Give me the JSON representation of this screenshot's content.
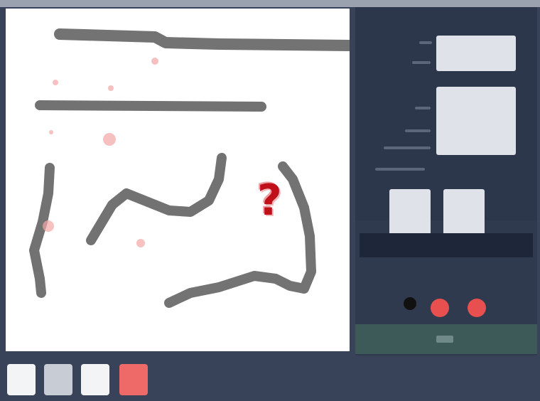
{
  "canvas": {
    "background": "#ffffff",
    "stroke_color": "#555555",
    "marker_color": "#f2a0a0"
  },
  "overlay": {
    "symbol": "?",
    "color": "#c0101a"
  },
  "side_panel": {
    "colors": {
      "panel": "#2f3a4f",
      "button": "#dfe3e9",
      "accent_dot": "#e8504f",
      "confirm_bar": "#3d5a58"
    }
  },
  "toolbar": {
    "tools": [
      {
        "icon": "blank-tile-icon",
        "active": false
      },
      {
        "icon": "blank-tile-icon",
        "active": false
      },
      {
        "icon": "blank-tile-icon",
        "active": false
      },
      {
        "icon": "red-tile-icon",
        "active": true
      }
    ]
  }
}
